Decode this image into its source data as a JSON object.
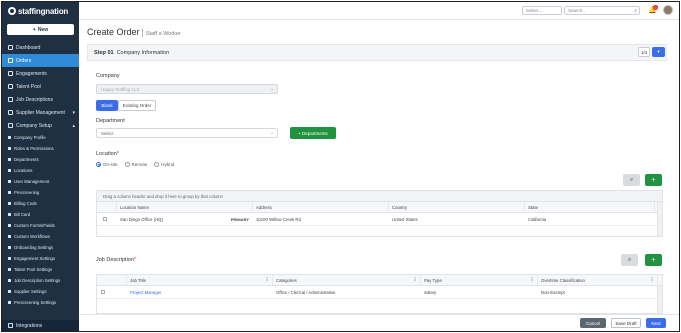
{
  "app": {
    "logo_text": "staffingnation"
  },
  "sidebar": {
    "new_label": "New",
    "items": [
      {
        "label": "Dashboard",
        "icon": "dashboard-icon",
        "active": false
      },
      {
        "label": "Orders",
        "icon": "orders-icon",
        "active": true
      },
      {
        "label": "Engagements",
        "icon": "engagements-icon",
        "active": false
      },
      {
        "label": "Talent Pool",
        "icon": "talent-icon",
        "active": false
      },
      {
        "label": "Job Descriptions",
        "icon": "jobs-icon",
        "active": false
      },
      {
        "label": "Supplier Management",
        "icon": "supplier-icon",
        "active": false,
        "caret": "▾"
      },
      {
        "label": "Company Setup",
        "icon": "company-icon",
        "active": false,
        "caret": "▴"
      }
    ],
    "sub_items": [
      "Company Profile",
      "Roles & Permissions",
      "Departments",
      "Locations",
      "User Management",
      "Prescreening",
      "Billing Code",
      "Bill Card",
      "Custom Forms/Fields",
      "Custom Workflows",
      "Onboarding Settings",
      "Engagement Settings",
      "Talent Pool Settings",
      "Job Description Settings",
      "Supplier Settings",
      "Prescreening Settings"
    ],
    "integrations_label": "Integrations"
  },
  "topbar": {
    "select_placeholder": "Select...",
    "search_placeholder": "Search...",
    "notification_count": "0"
  },
  "page": {
    "title": "Create Order",
    "subtitle": "Staff a Worker"
  },
  "step": {
    "number": "Step 01",
    "title": "Company Information",
    "counter": "1/4"
  },
  "form": {
    "company_label": "Company",
    "company_value": "Happy Staffing LLC",
    "blank_label": "Blank",
    "existing_label": "Existing Order",
    "department_label": "Department",
    "department_placeholder": "Select",
    "departments_button": "+ Departments",
    "location_label": "Location",
    "required_mark": "*",
    "location_options": [
      "On-site",
      "Remote",
      "Hybrid"
    ],
    "location_selected": "On-site"
  },
  "location_grid": {
    "group_hint": "Drag a column header and drop it here to group by that column",
    "columns": [
      "Location Name",
      "Address",
      "Country",
      "State"
    ],
    "rows": [
      {
        "name": "San Diego Office (HQ)",
        "badge": "PRIMARY",
        "address": "10100 Willow Creek Rd",
        "country": "United States",
        "state": "California"
      }
    ]
  },
  "job_description": {
    "label": "Job Description",
    "columns": [
      "Job Title",
      "Categories",
      "Pay Type",
      "Overtime Classification"
    ],
    "rows": [
      {
        "title": "Project Manager",
        "category": "Office / Clerical / Administrative",
        "pay_type": "Salary",
        "overtime": "Non-Exempt"
      }
    ]
  },
  "footer": {
    "cancel": "Cancel",
    "save_draft": "Save Draft",
    "next": "Next"
  },
  "colors": {
    "sidebar": "#1f3043",
    "accent": "#3a6ee6",
    "active_nav": "#2f8bd8",
    "green": "#21923f"
  }
}
